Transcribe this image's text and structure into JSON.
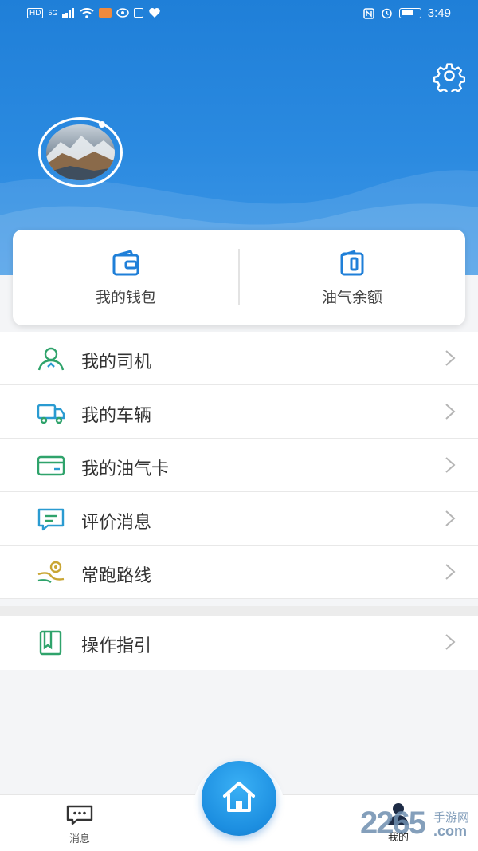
{
  "status_bar": {
    "left_labels": [
      "HD",
      "5G"
    ],
    "time": "3:49"
  },
  "header": {
    "settings_icon": "gear-icon",
    "avatar_icon": "avatar"
  },
  "card": {
    "items": [
      {
        "label": "我的钱包",
        "icon": "wallet-icon"
      },
      {
        "label": "油气余额",
        "icon": "balance-card-icon"
      }
    ]
  },
  "menu": {
    "items": [
      {
        "label": "我的司机",
        "icon": "driver-icon",
        "color": "#2fa36b"
      },
      {
        "label": "我的车辆",
        "icon": "truck-icon",
        "color": "#2a9bd1"
      },
      {
        "label": "我的油气卡",
        "icon": "card-icon",
        "color": "#2fa36b"
      },
      {
        "label": "评价消息",
        "icon": "message-icon",
        "color": "#2a9bd1"
      },
      {
        "label": "常跑路线",
        "icon": "route-icon",
        "color": "#c9a634"
      }
    ],
    "guide": {
      "label": "操作指引",
      "icon": "guide-icon",
      "color": "#2fa36b"
    }
  },
  "tabbar": {
    "messages_label": "消息",
    "home_icon": "home-icon",
    "me_label": "我的"
  },
  "watermark": {
    "number": "2265",
    "sub": "手游网",
    "domain": ".com"
  },
  "colors": {
    "header_blue": "#1f7fd8",
    "accent_green": "#2fa36b",
    "accent_blue": "#2a9bd1"
  }
}
